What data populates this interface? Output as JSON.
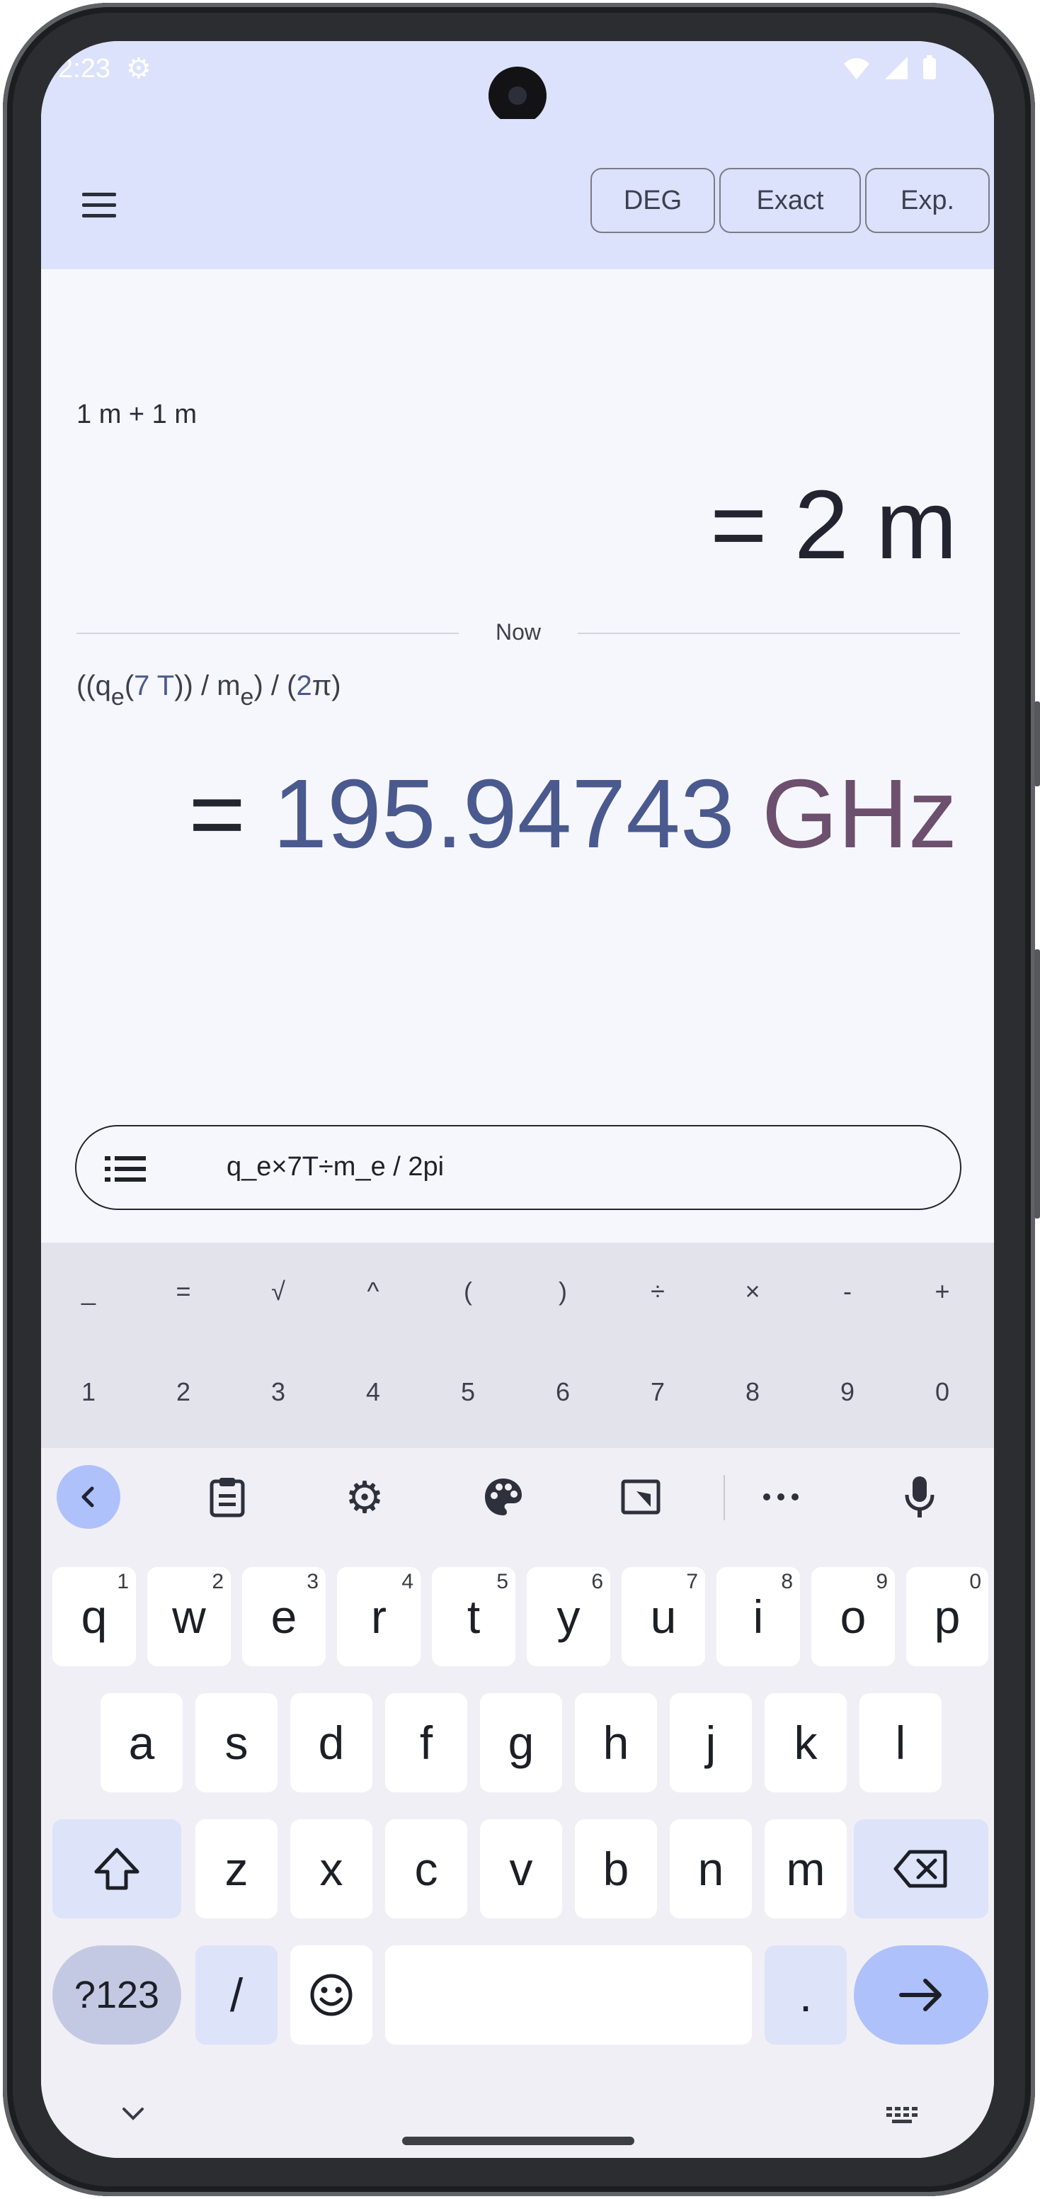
{
  "status_bar": {
    "time": "2:23"
  },
  "toolbar": {
    "angle_mode": "DEG",
    "result_mode": "Exact",
    "notation": "Exp."
  },
  "history": [
    {
      "expression": "1 m + 1 m",
      "result": "= 2 m"
    }
  ],
  "divider_label": "Now",
  "current": {
    "expression_parts": {
      "p1": "((q",
      "p2": "e",
      "p3": "(",
      "p4": "7 T",
      "p5": ")) / m",
      "p6": "e",
      "p7": ") / (",
      "p8": "2",
      "p9": "π",
      "p10": ")"
    },
    "result_eq": "=",
    "result_value": "195.94743",
    "result_unit": "GHz"
  },
  "input": {
    "text": "q_e×7T÷m_e / 2pi"
  },
  "symbol_keys": [
    "_",
    "=",
    "√",
    "^",
    "(",
    ")",
    "÷",
    "×",
    "-",
    "+"
  ],
  "digit_keys": [
    "1",
    "2",
    "3",
    "4",
    "5",
    "6",
    "7",
    "8",
    "9",
    "0"
  ],
  "keyboard": {
    "row1": [
      {
        "k": "q",
        "h": "1"
      },
      {
        "k": "w",
        "h": "2"
      },
      {
        "k": "e",
        "h": "3"
      },
      {
        "k": "r",
        "h": "4"
      },
      {
        "k": "t",
        "h": "5"
      },
      {
        "k": "y",
        "h": "6"
      },
      {
        "k": "u",
        "h": "7"
      },
      {
        "k": "i",
        "h": "8"
      },
      {
        "k": "o",
        "h": "9"
      },
      {
        "k": "p",
        "h": "0"
      }
    ],
    "row2": [
      "a",
      "s",
      "d",
      "f",
      "g",
      "h",
      "j",
      "k",
      "l"
    ],
    "row3": [
      "z",
      "x",
      "c",
      "v",
      "b",
      "n",
      "m"
    ],
    "symbols_key": "?123",
    "slash_key": "/",
    "period_key": ".",
    "tools": [
      "back-icon",
      "clipboard-icon",
      "settings-icon",
      "palette-icon",
      "resize-icon",
      "more-icon",
      "mic-icon"
    ]
  },
  "colors": {
    "accent_blue": "#4a5a8f",
    "unit_purple": "#6d4f6e",
    "topbar": "#dce2fb"
  }
}
